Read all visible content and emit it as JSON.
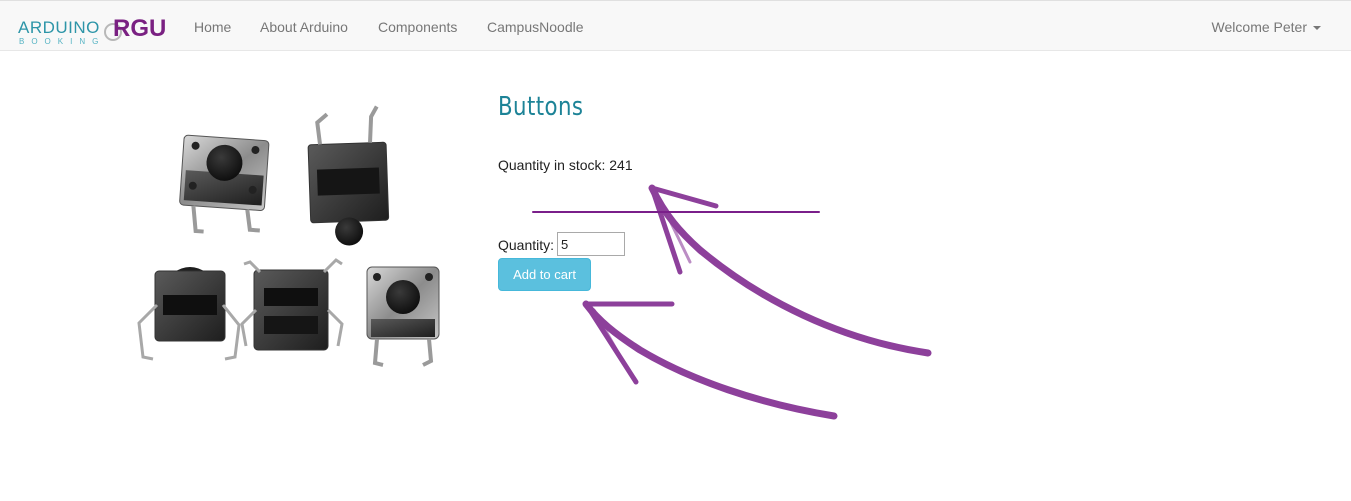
{
  "navbar": {
    "brand": {
      "arduino": "ARDUINO",
      "booking": "BOOKING",
      "rgu": "RGU"
    },
    "links": [
      {
        "label": "Home"
      },
      {
        "label": "About Arduino"
      },
      {
        "label": "Components"
      },
      {
        "label": "CampusNoodle"
      }
    ],
    "user_menu": {
      "label": "Welcome Peter"
    }
  },
  "product": {
    "title": "Buttons",
    "stock_text": "Quantity in stock: 241",
    "quantity_label": "Quantity:",
    "quantity_value": "5",
    "add_to_cart_label": "Add to cart"
  },
  "colors": {
    "accent_teal": "#1d8397",
    "brand_purple": "#7a2182",
    "button_info": "#5bc0de",
    "annotation_purple": "#7a1f8a"
  }
}
